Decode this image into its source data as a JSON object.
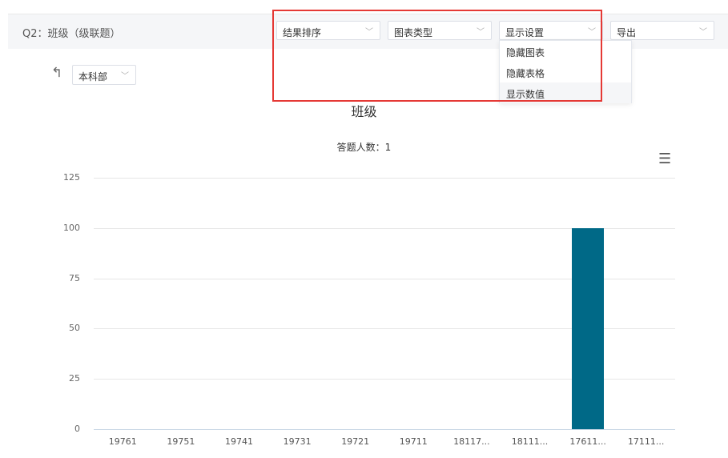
{
  "question_title": "Q2：班级（级联题）",
  "toolbar": {
    "sort": "结果排序",
    "chart_type": "图表类型",
    "display": "显示设置",
    "export": "导出"
  },
  "display_menu": {
    "items": [
      "隐藏图表",
      "隐藏表格",
      "显示数值"
    ],
    "highlighted_index": 2
  },
  "back_icon": "up-arrow-return-icon",
  "level_select": "本科部",
  "chart_menu_icon": "hamburger-menu-icon",
  "chart_data": {
    "type": "bar",
    "title": "班级",
    "subtitle": "答题人数：1",
    "categories": [
      "19761",
      "19751",
      "19741",
      "19731",
      "19721",
      "19711",
      "18117...",
      "18111...",
      "17611...",
      "17111..."
    ],
    "values": [
      0,
      0,
      0,
      0,
      0,
      0,
      0,
      0,
      100,
      0
    ],
    "ylim": [
      0,
      125
    ],
    "yticks": [
      0,
      25,
      50,
      75,
      100,
      125
    ],
    "grid": true,
    "bar_color": "#006987"
  }
}
